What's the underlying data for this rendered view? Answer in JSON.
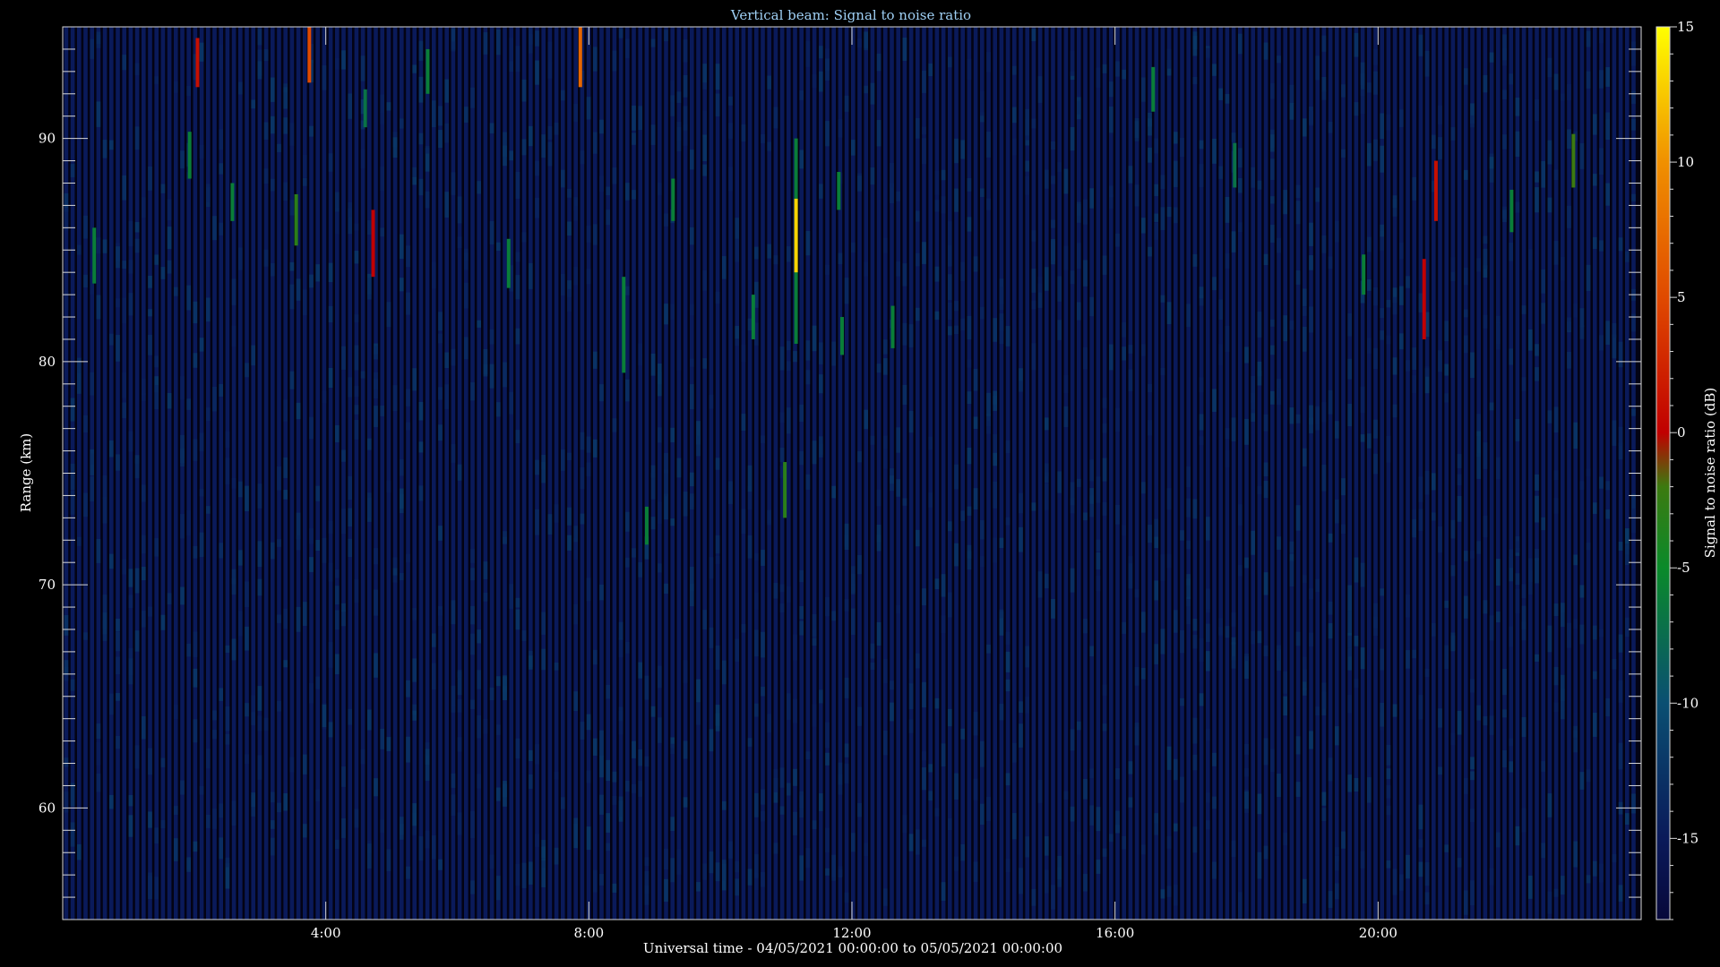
{
  "chart_data": {
    "type": "heatmap",
    "title": "Vertical beam: Signal to noise ratio",
    "xlabel": "Universal time - 04/05/2021 00:00:00 to 05/05/2021 00:00:00",
    "ylabel": "Range (km)",
    "colorbar_label": "Signal to noise ratio (dB)",
    "xlim_hours": [
      0,
      24
    ],
    "ylim_km": [
      55,
      95
    ],
    "x_ticks": [
      {
        "hour": 4,
        "label": "4:00"
      },
      {
        "hour": 8,
        "label": "8:00"
      },
      {
        "hour": 12,
        "label": "12:00"
      },
      {
        "hour": 16,
        "label": "16:00"
      },
      {
        "hour": 20,
        "label": "20:00"
      }
    ],
    "y_ticks": [
      {
        "km": 60,
        "label": "60"
      },
      {
        "km": 70,
        "label": "70"
      },
      {
        "km": 80,
        "label": "80"
      },
      {
        "km": 90,
        "label": "90"
      }
    ],
    "colorbar_range_db": [
      -18,
      15
    ],
    "colorbar_ticks": [
      {
        "db": -15,
        "label": "-15"
      },
      {
        "db": -10,
        "label": "-10"
      },
      {
        "db": -5,
        "label": "-5"
      },
      {
        "db": 0,
        "label": "0"
      },
      {
        "db": 5,
        "label": "5"
      },
      {
        "db": 10,
        "label": "10"
      },
      {
        "db": 15,
        "label": "15"
      }
    ],
    "colormap_stops_db": [
      {
        "db": -18,
        "color": "#07083a"
      },
      {
        "db": -15,
        "color": "#0a1a5a"
      },
      {
        "db": -10,
        "color": "#0a4f72"
      },
      {
        "db": -5,
        "color": "#0a8a2a"
      },
      {
        "db": -2,
        "color": "#3c7a10"
      },
      {
        "db": 0,
        "color": "#c00000"
      },
      {
        "db": 5,
        "color": "#e04a00"
      },
      {
        "db": 10,
        "color": "#f09000"
      },
      {
        "db": 15,
        "color": "#ffff00"
      }
    ],
    "background_db": -15,
    "events": [
      {
        "hour": 0.48,
        "km_low": 83.5,
        "km_high": 86.0,
        "db": -6
      },
      {
        "hour": 1.93,
        "km_low": 88.2,
        "km_high": 90.3,
        "db": -6
      },
      {
        "hour": 2.05,
        "km_low": 92.3,
        "km_high": 94.5,
        "db": 1
      },
      {
        "hour": 2.58,
        "km_low": 86.3,
        "km_high": 88.0,
        "db": -6
      },
      {
        "hour": 3.55,
        "km_low": 85.2,
        "km_high": 87.5,
        "db": -3
      },
      {
        "hour": 3.75,
        "km_low": 92.5,
        "km_high": 95.0,
        "db": 5
      },
      {
        "hour": 4.6,
        "km_low": 90.5,
        "km_high": 92.2,
        "db": -7
      },
      {
        "hour": 4.72,
        "km_low": 83.8,
        "km_high": 86.8,
        "db": 0
      },
      {
        "hour": 5.55,
        "km_low": 92.0,
        "km_high": 94.0,
        "db": -6
      },
      {
        "hour": 6.78,
        "km_low": 83.3,
        "km_high": 85.5,
        "db": -6
      },
      {
        "hour": 7.87,
        "km_low": 92.3,
        "km_high": 95.0,
        "db": 7
      },
      {
        "hour": 8.53,
        "km_low": 79.5,
        "km_high": 83.8,
        "db": -6
      },
      {
        "hour": 8.88,
        "km_low": 71.8,
        "km_high": 73.5,
        "db": -6
      },
      {
        "hour": 9.28,
        "km_low": 86.3,
        "km_high": 88.2,
        "db": -6
      },
      {
        "hour": 10.5,
        "km_low": 81.0,
        "km_high": 83.0,
        "db": -6
      },
      {
        "hour": 10.98,
        "km_low": 73.0,
        "km_high": 75.5,
        "db": -3
      },
      {
        "hour": 11.15,
        "km_low": 80.8,
        "km_high": 90.0,
        "db": -6
      },
      {
        "hour": 11.15,
        "km_low": 84.0,
        "km_high": 87.3,
        "db": 13
      },
      {
        "hour": 11.8,
        "km_low": 86.8,
        "km_high": 88.5,
        "db": -6
      },
      {
        "hour": 11.85,
        "km_low": 80.3,
        "km_high": 82.0,
        "db": -6
      },
      {
        "hour": 12.62,
        "km_low": 80.6,
        "km_high": 82.5,
        "db": -6
      },
      {
        "hour": 16.58,
        "km_low": 91.2,
        "km_high": 93.2,
        "db": -6
      },
      {
        "hour": 17.82,
        "km_low": 87.8,
        "km_high": 89.8,
        "db": -7
      },
      {
        "hour": 19.78,
        "km_low": 83.0,
        "km_high": 84.8,
        "db": -6
      },
      {
        "hour": 20.7,
        "km_low": 81.0,
        "km_high": 84.6,
        "db": 0
      },
      {
        "hour": 20.88,
        "km_low": 86.3,
        "km_high": 89.0,
        "db": 1
      },
      {
        "hour": 22.03,
        "km_low": 85.8,
        "km_high": 87.7,
        "db": -6
      },
      {
        "hour": 22.97,
        "km_low": 87.8,
        "km_high": 90.2,
        "db": -2
      }
    ]
  }
}
